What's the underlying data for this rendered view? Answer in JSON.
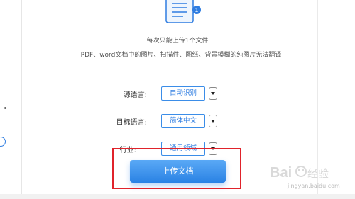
{
  "hint": {
    "line1": "每次只能上传1个文件",
    "line2": "PDF、word文档中的图片、扫描件、图纸、背景模糊的纯图片无法翻译"
  },
  "source_language": {
    "label": "源语言:",
    "value": "自动识别"
  },
  "target_language": {
    "label": "目标语言:",
    "value": "简体中文"
  },
  "industry": {
    "label": "行业:",
    "value": "通用领域"
  },
  "upload_button": {
    "label": "上传文档"
  },
  "doc_icon": {
    "badge": "1"
  },
  "watermark": {
    "logo_text": "Bai经验",
    "url": "jingyan.baidu.com"
  },
  "colors": {
    "accent": "#2f7de1",
    "highlight": "#e0232b"
  }
}
